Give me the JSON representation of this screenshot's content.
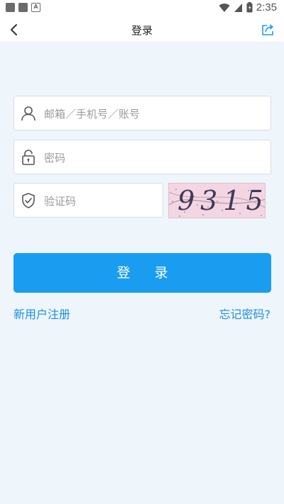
{
  "status_bar": {
    "time": "2:35",
    "icons": [
      "notification-square-icon",
      "notification-square-icon",
      "notification-a-icon",
      "wifi-icon",
      "signal-icon",
      "battery-icon"
    ]
  },
  "header": {
    "title": "登录",
    "back_icon": "chevron-left-icon",
    "share_icon": "share-icon"
  },
  "form": {
    "account_placeholder": "邮箱／手机号／账号",
    "password_placeholder": "密码",
    "captcha_placeholder": "验证码",
    "captcha_text": "9315"
  },
  "actions": {
    "login_label": "登 录",
    "register_label": "新用户注册",
    "forgot_label": "忘记密码?"
  },
  "colors": {
    "accent": "#1a9df1",
    "link": "#1a8fe6",
    "background": "#eef5fb"
  }
}
